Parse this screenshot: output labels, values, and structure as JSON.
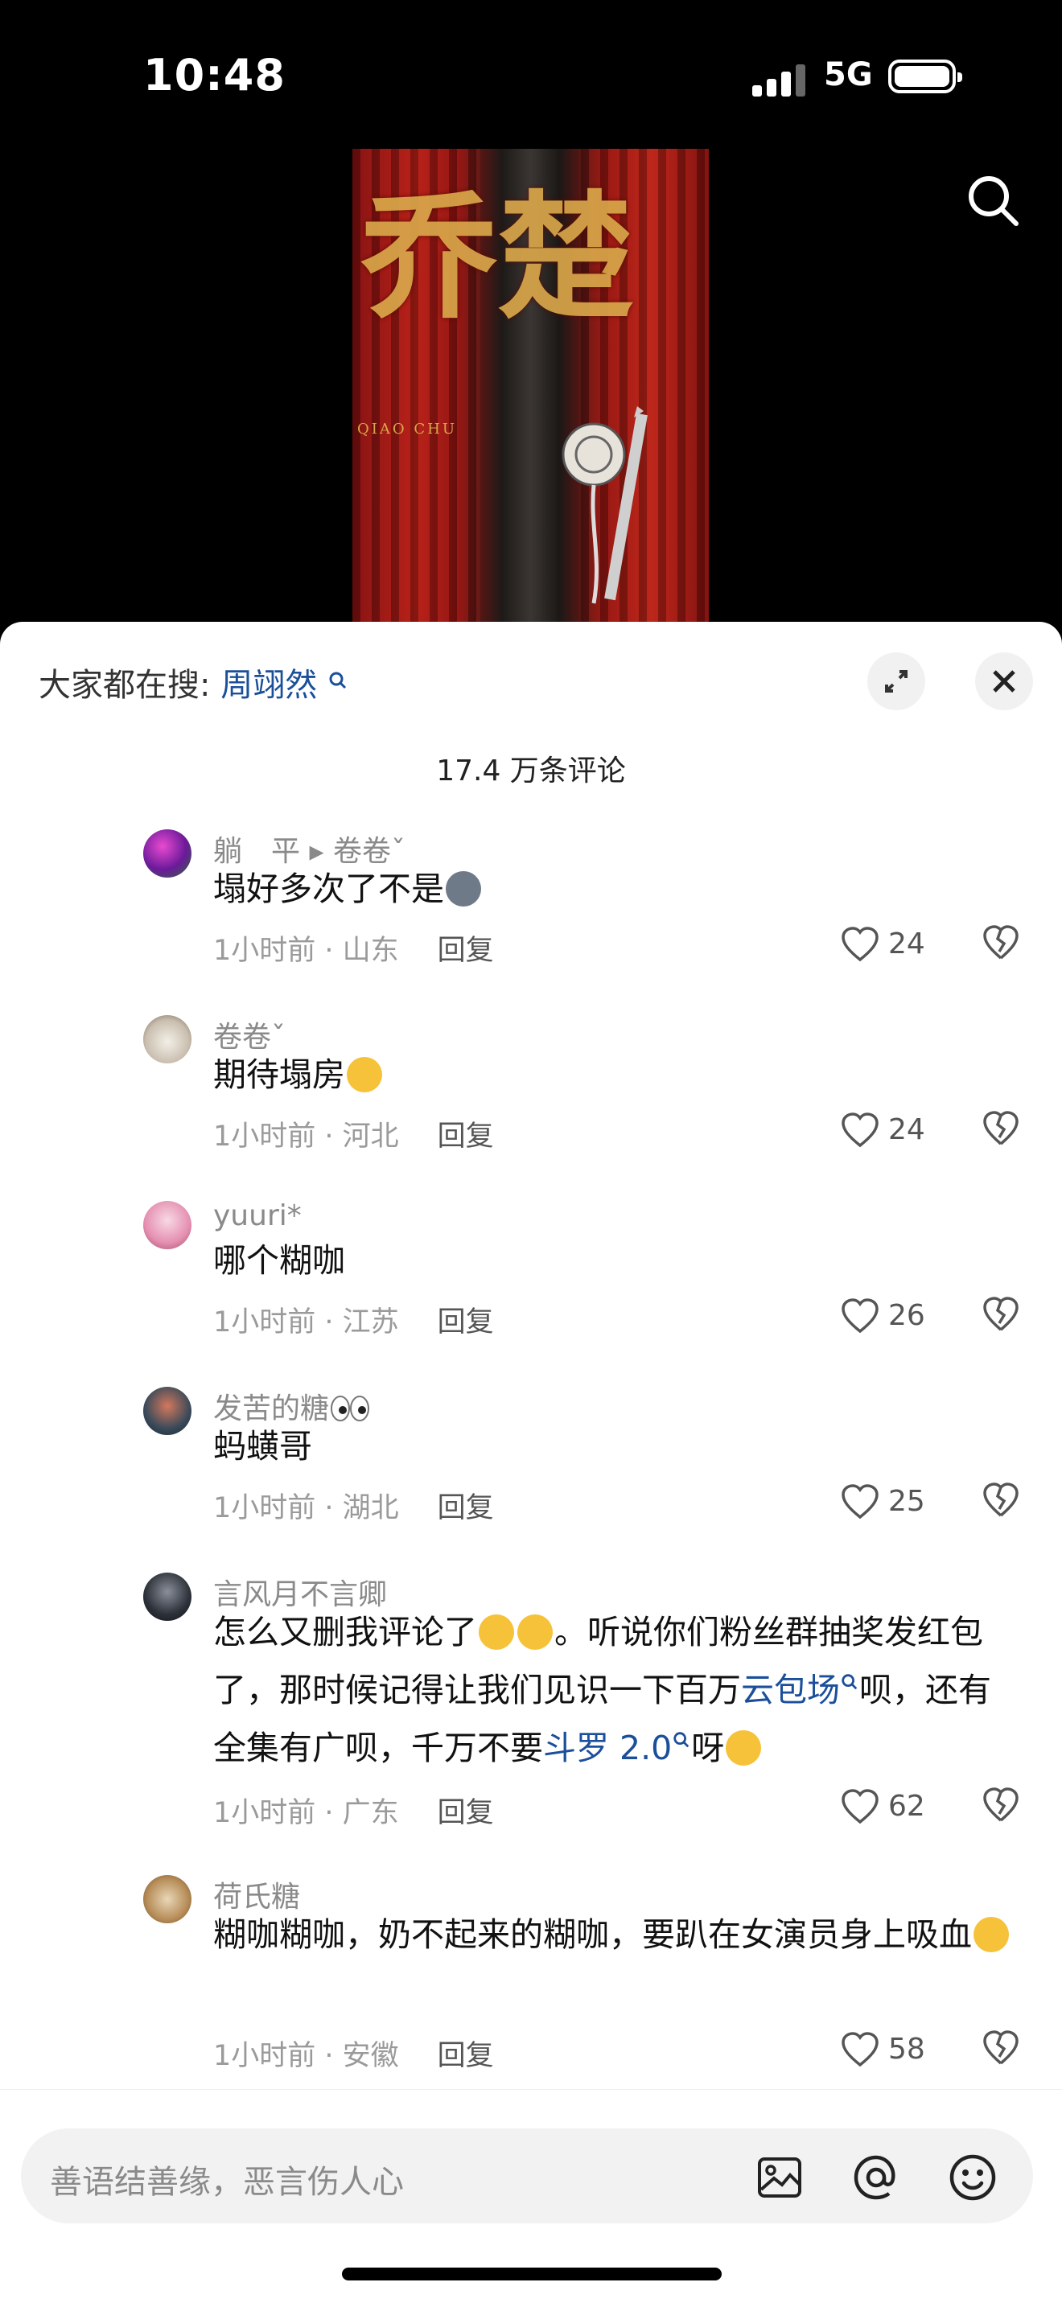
{
  "status": {
    "time": "10:48",
    "network": "5G"
  },
  "poster": {
    "title_text": "乔楚",
    "sub_text": "QIAO CHU"
  },
  "sheet": {
    "hot_prefix": "大家都在搜:",
    "hot_term": "周翊然",
    "count": "17.4 万条评论"
  },
  "comments": [
    {
      "name": "躺　平 ▸ 卷卷ˇ",
      "text": "塌好多次了不是",
      "time": "1小时前 · 山东",
      "reply": "回复",
      "likes": "24"
    },
    {
      "name": "卷卷ˇ",
      "text": "期待塌房",
      "time": "1小时前 · 河北",
      "reply": "回复",
      "likes": "24"
    },
    {
      "name": "yuuri*",
      "text": "哪个糊咖",
      "time": "1小时前 · 江苏",
      "reply": "回复",
      "likes": "26"
    },
    {
      "name": "发苦的糖",
      "text": "蚂蟥哥",
      "time": "1小时前 · 湖北",
      "reply": "回复",
      "likes": "25"
    },
    {
      "name": "言风月不言卿",
      "text_a": "怎么又删我评论了",
      "text_b": "。听说你们粉丝群抽奖发红包了，那时候记得让我们见识一下百万",
      "link1": "云包场",
      "text_c": "呗，还有全集有广呗，千万不要",
      "link2": "斗罗 2.0",
      "text_d": "呀",
      "time": "1小时前 · 广东",
      "reply": "回复",
      "likes": "62"
    },
    {
      "name": "荷氏糖",
      "text": "糊咖糊咖，奶不起来的糊咖，要趴在女演员身上吸血",
      "time": "1小时前 · 安徽",
      "reply": "回复",
      "likes": "58"
    }
  ],
  "input": {
    "placeholder": "善语结善缘，恶言伤人心"
  },
  "icons": [
    "search-icon",
    "expand-icon",
    "close-icon",
    "heart-icon",
    "dislike-icon",
    "image-icon",
    "at-icon",
    "emoji-icon"
  ],
  "colors": {
    "link": "#1b4f9a",
    "meta": "#9a9a9a"
  }
}
